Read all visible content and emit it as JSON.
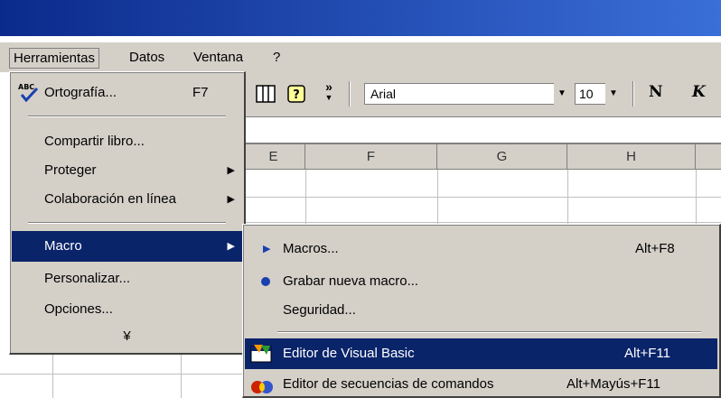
{
  "menubar": {
    "herramientas": "Herramientas",
    "datos": "Datos",
    "ventana": "Ventana",
    "help": "?"
  },
  "toolbar": {
    "font_name": "Arial",
    "font_size": "10",
    "bold_label": "N",
    "italic_label": "K",
    "more_label": "»"
  },
  "columns": [
    "E",
    "F",
    "G",
    "H"
  ],
  "herramientas_menu": {
    "items": [
      {
        "label": "Ortografía...",
        "shortcut": "F7"
      },
      {
        "label": "Compartir libro..."
      },
      {
        "label": "Proteger"
      },
      {
        "label": "Colaboración en línea"
      },
      {
        "label": "Macro"
      },
      {
        "label": "Personalizar..."
      },
      {
        "label": "Opciones..."
      }
    ],
    "expand_label": "¥"
  },
  "macro_menu": {
    "items": [
      {
        "label": "Macros...",
        "shortcut": "Alt+F8"
      },
      {
        "label": "Grabar nueva macro..."
      },
      {
        "label": "Seguridad..."
      },
      {
        "label": "Editor de Visual Basic",
        "shortcut": "Alt+F11"
      },
      {
        "label": "Editor de secuencias de comandos",
        "shortcut": "Alt+Mayús+F11"
      }
    ]
  },
  "colors": {
    "highlight": "#0a246a",
    "menu_bg": "#d4d0c8",
    "titlebar": "#0b2a8c"
  }
}
